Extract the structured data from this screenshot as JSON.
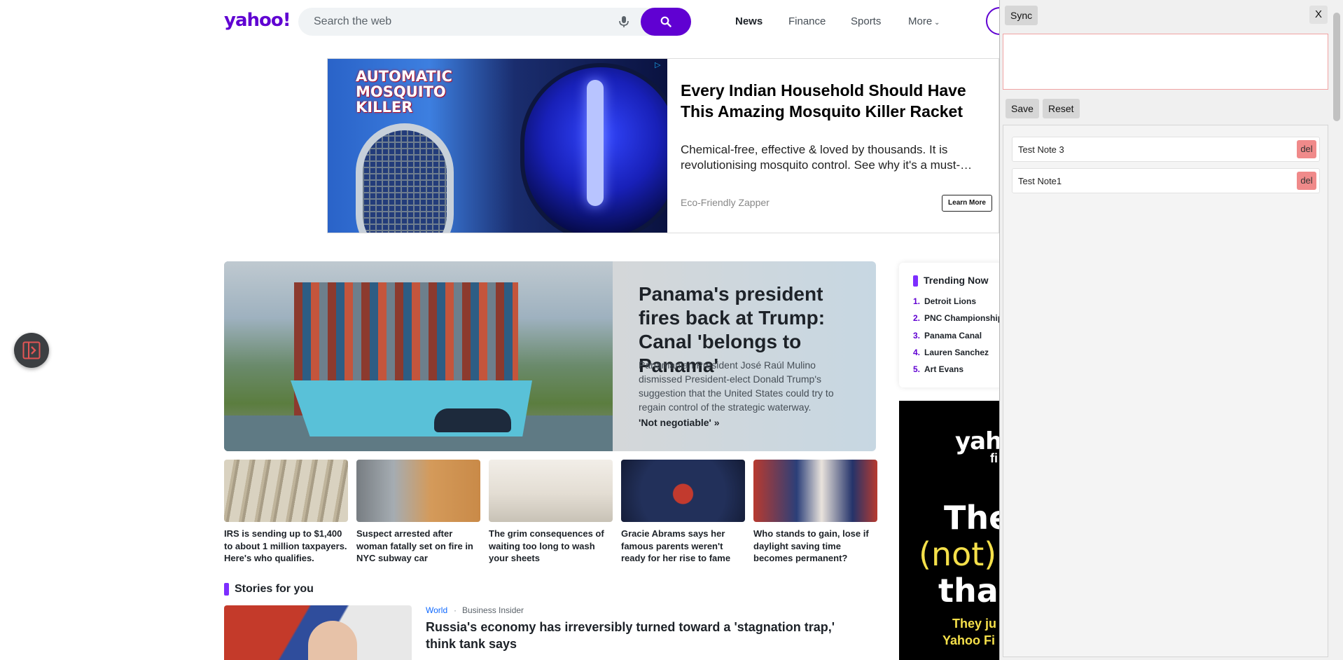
{
  "header": {
    "logo": "yahoo!",
    "search_placeholder": "Search the web",
    "nav": [
      "News",
      "Finance",
      "Sports",
      "More"
    ]
  },
  "ad": {
    "image_text": "AUTOMATIC MOSQUITO KILLER",
    "title": "Every Indian Household Should Have This Amazing Mosquito Killer Racket",
    "desc_line1": "Chemical-free, effective & loved by thousands. It is",
    "desc_line2": "revolutionising mosquito control. See why it's a must-…",
    "source": "Eco-Friendly Zapper",
    "cta": "Learn More"
  },
  "hero": {
    "title": "Panama's president fires back at Trump: Canal 'belongs to Panama'",
    "summary": "Panamanian President José Raúl Mulino dismissed President-elect Donald Trump's suggestion that the United States could try to regain control of the strategic waterway.",
    "link": "'Not negotiable' »"
  },
  "cards": [
    {
      "title": "IRS is sending up to $1,400 to about 1 million taxpayers. Here's who qualifies."
    },
    {
      "title": "Suspect arrested after woman fatally set on fire in NYC subway car"
    },
    {
      "title": "The grim consequences of waiting too long to wash your sheets"
    },
    {
      "title": "Gracie Abrams says her famous parents weren't ready for her rise to fame"
    },
    {
      "title": "Who stands to gain, lose if daylight saving time becomes permanent?"
    }
  ],
  "stories": {
    "heading": "Stories for you",
    "category": "World",
    "source": "Business Insider",
    "title": "Russia's economy has irreversibly turned toward a 'stagnation trap,' think tank says"
  },
  "trending": {
    "title": "Trending Now",
    "items": [
      "Detroit Lions",
      "PNC Championship",
      "Panama Canal",
      "Lauren Sanchez",
      "Art Evans"
    ]
  },
  "right_ad": {
    "logo": "yah",
    "logo_sub": "fi",
    "line1": "The",
    "line2": "(not) l",
    "line3": "thar",
    "line4": "They ju",
    "line5": "Yahoo Fi"
  },
  "panel": {
    "sync": "Sync",
    "close": "X",
    "save": "Save",
    "reset": "Reset",
    "notes": [
      "Test Note 3",
      "Test Note1"
    ],
    "del": "del"
  },
  "colors": {
    "brand": "#6001d2",
    "accent": "#7d2eff",
    "del": "#f08a8a"
  }
}
